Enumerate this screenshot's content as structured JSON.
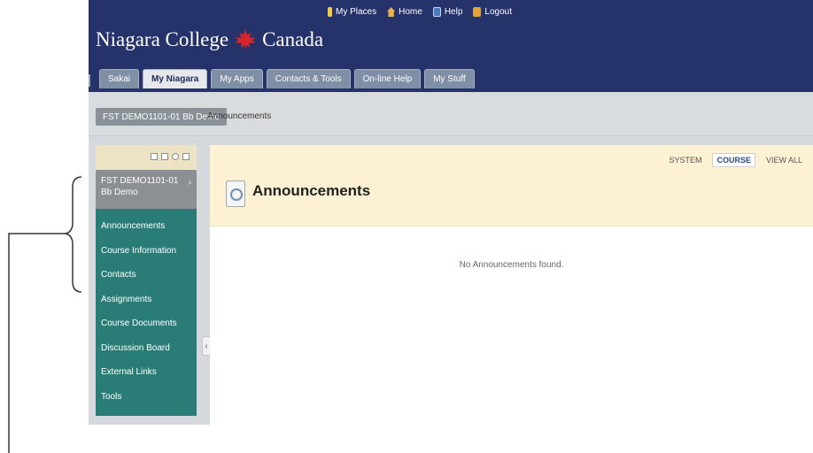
{
  "header": {
    "top_links": [
      {
        "label": "My Places",
        "icon": "places-icon"
      },
      {
        "label": "Home",
        "icon": "home-icon"
      },
      {
        "label": "Help",
        "icon": "help-icon"
      },
      {
        "label": "Logout",
        "icon": "logout-icon"
      }
    ],
    "logo": {
      "left": "Niagara College",
      "right": "Canada",
      "icon": "maple-leaf-icon",
      "leaf_color": "#d8232a"
    },
    "bg_color": "#26336b"
  },
  "tabs": [
    {
      "label": "Sakai"
    },
    {
      "label": "My Niagara"
    },
    {
      "label": "My Apps"
    },
    {
      "label": "Contacts & Tools"
    },
    {
      "label": "On-line Help"
    },
    {
      "label": "My Stuff"
    }
  ],
  "breadcrumb": {
    "course": "FST DEMO1101-01 Bb Demo",
    "page": "Announcements"
  },
  "sidebar": {
    "course_title": "FST DEMO1101-01 Bb Demo",
    "items": [
      "Announcements",
      "Course Information",
      "Contacts",
      "Assignments",
      "Course Documents",
      "Discussion Board",
      "External Links",
      "Tools"
    ],
    "bg_color": "#2a7d76"
  },
  "content": {
    "view_options": [
      "SYSTEM",
      "COURSE",
      "VIEW ALL"
    ],
    "title": "Announcements",
    "empty_message": "No Announcements found."
  }
}
